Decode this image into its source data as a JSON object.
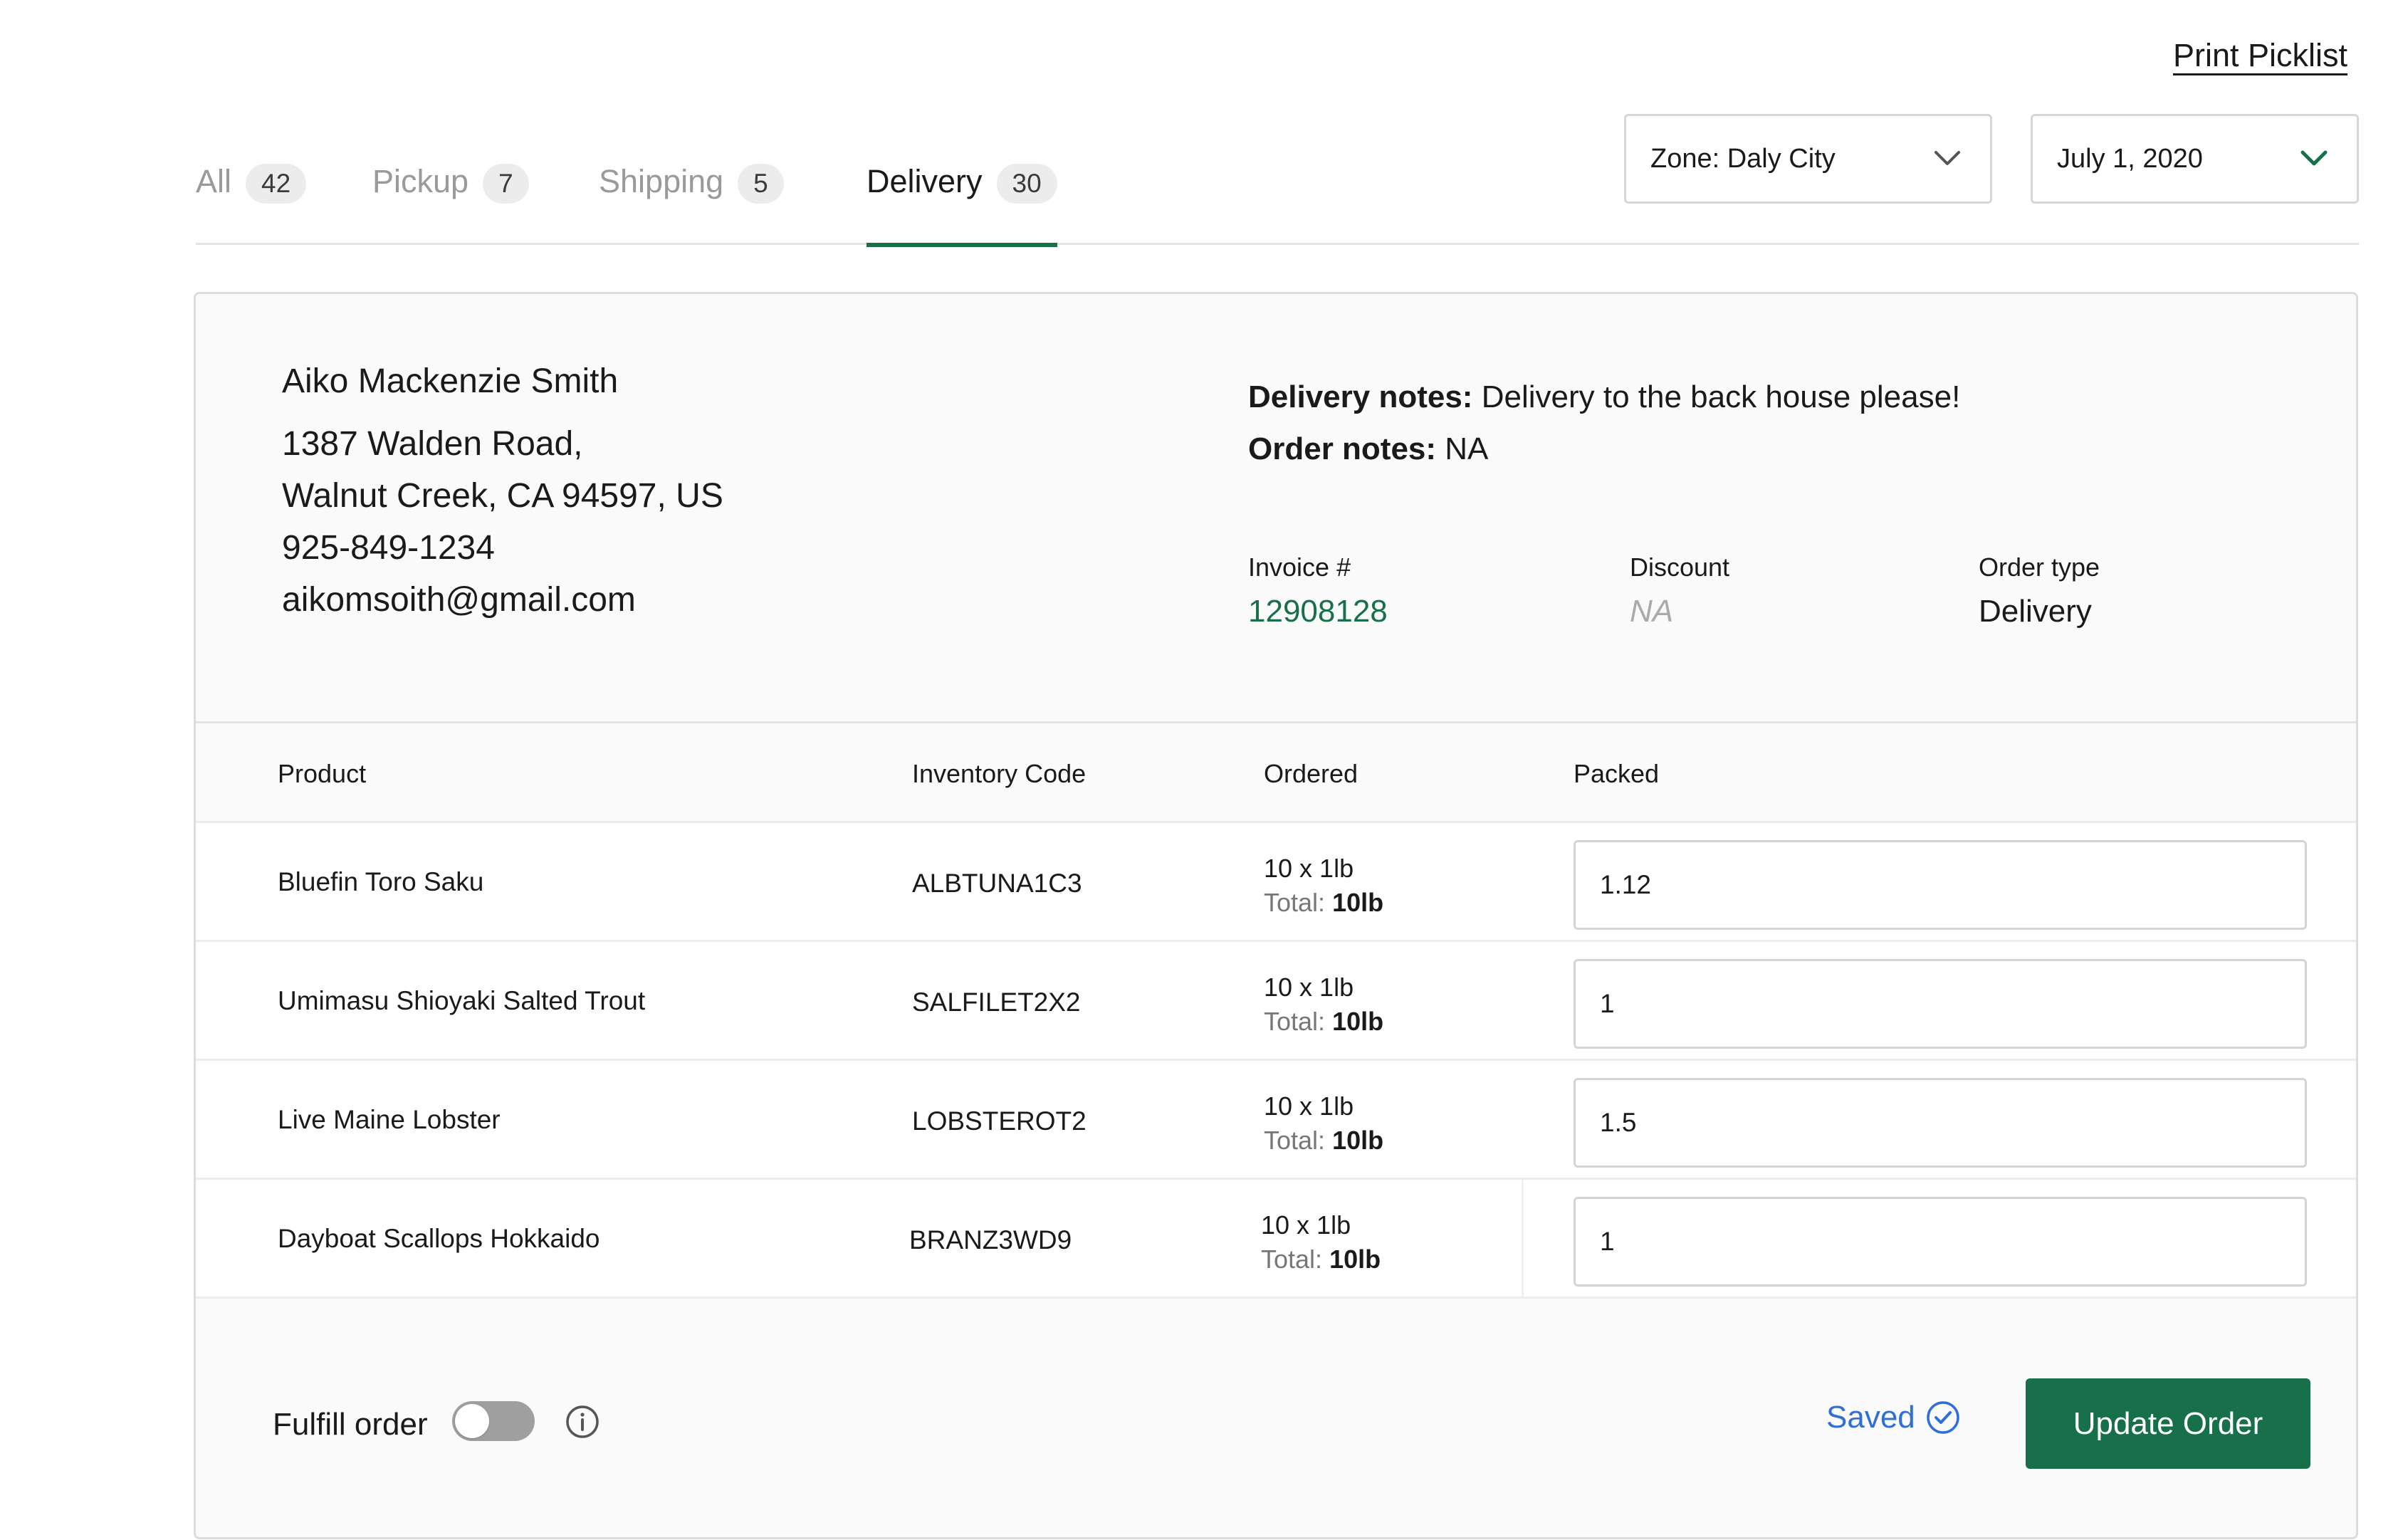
{
  "header": {
    "print_label": "Print Picklist"
  },
  "tabs": [
    {
      "label": "All",
      "count": "42"
    },
    {
      "label": "Pickup",
      "count": "7"
    },
    {
      "label": "Shipping",
      "count": "5"
    },
    {
      "label": "Delivery",
      "count": "30",
      "active": true
    }
  ],
  "filters": {
    "zone": "Zone: Daly City",
    "date": "July 1, 2020"
  },
  "customer": {
    "name": "Aiko Mackenzie Smith",
    "address1": "1387 Walden Road,",
    "address2": "Walnut Creek, CA 94597, US",
    "phone": "925-849-1234",
    "email": "aikomsoith@gmail.com"
  },
  "notes": {
    "delivery_label": "Delivery notes:",
    "delivery_value": "Delivery to the back house please!",
    "order_label": "Order notes:",
    "order_value": "NA"
  },
  "meta": {
    "invoice_label": "Invoice #",
    "invoice_value": "12908128",
    "discount_label": "Discount",
    "discount_value": "NA",
    "ordertype_label": "Order type",
    "ordertype_value": "Delivery"
  },
  "table": {
    "headers": {
      "product": "Product",
      "code": "Inventory Code",
      "ordered": "Ordered",
      "packed": "Packed"
    },
    "rows": [
      {
        "product": "Bluefin Toro Saku",
        "code": "ALBTUNA1C3",
        "ordered": "10 x 1lb",
        "total_label": "Total:",
        "total_value": "10lb",
        "packed": "1.12"
      },
      {
        "product": "Umimasu Shioyaki Salted Trout",
        "code": "SALFILET2X2",
        "ordered": "10 x 1lb",
        "total_label": "Total:",
        "total_value": "10lb",
        "packed": "1"
      },
      {
        "product": "Live Maine Lobster",
        "code": "LOBSTEROT2",
        "ordered": "10 x 1lb",
        "total_label": "Total:",
        "total_value": "10lb",
        "packed": "1.5"
      },
      {
        "product": "Dayboat Scallops Hokkaido",
        "code": "BRANZ3WD9",
        "ordered": "10 x 1lb",
        "total_label": "Total:",
        "total_value": "10lb",
        "packed": "1"
      }
    ]
  },
  "footer": {
    "fulfill_label": "Fulfill order",
    "fulfill_on": false,
    "saved_label": "Saved",
    "update_label": "Update Order"
  },
  "colors": {
    "brand_green": "#17704a",
    "saved_blue": "#2f6fd6"
  }
}
